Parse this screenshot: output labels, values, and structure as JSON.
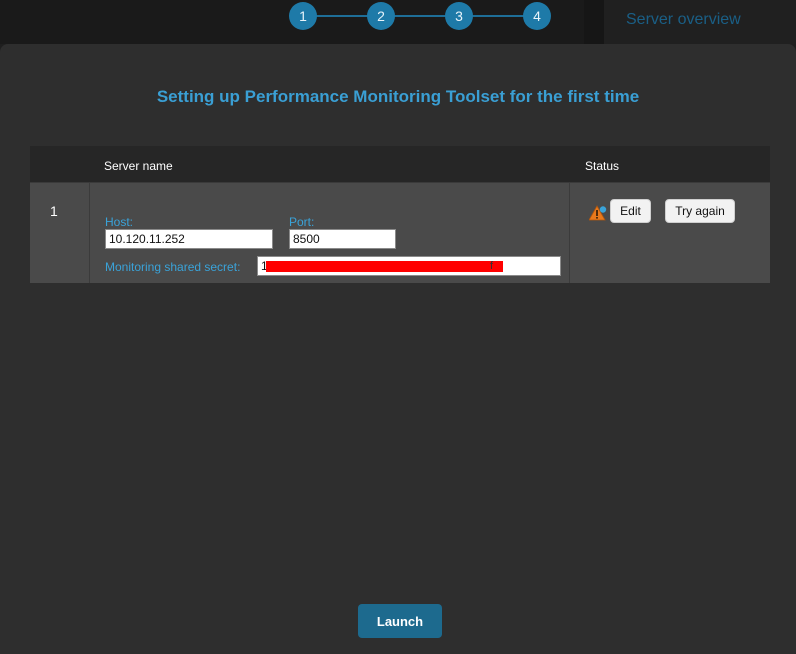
{
  "background": {
    "panel_title": "Server overview"
  },
  "wizard": {
    "steps": [
      "1",
      "2",
      "3",
      "4"
    ]
  },
  "modal": {
    "title": "Setting up Performance Monitoring Toolset for the first time",
    "table": {
      "headers": {
        "server_name": "Server name",
        "status": "Status"
      },
      "rows": [
        {
          "number": "1",
          "host_label": "Host:",
          "host_value": "10.120.11.252",
          "port_label": "Port:",
          "port_value": "8500",
          "secret_label": "Monitoring shared secret:",
          "secret_prefix": "1",
          "secret_suffix": "f",
          "status_icon": "warning-icon",
          "edit_label": "Edit",
          "retry_label": "Try again"
        }
      ]
    },
    "launch_label": "Launch"
  },
  "colors": {
    "accent": "#3a9fd4",
    "step": "#1e7aa8",
    "button_primary": "#1d6a8e",
    "warning": "#e8791c"
  }
}
